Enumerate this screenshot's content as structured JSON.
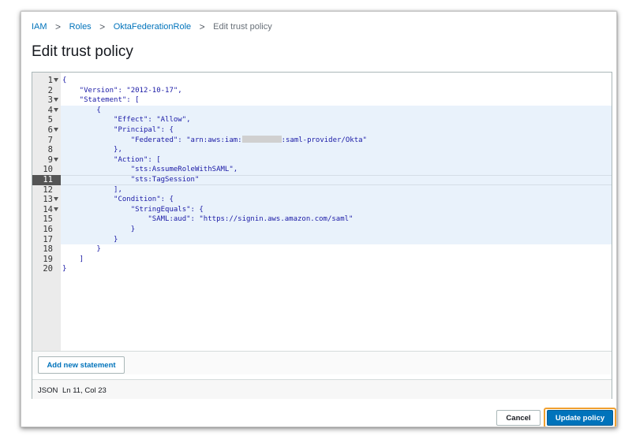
{
  "breadcrumb": {
    "items": [
      "IAM",
      "Roles",
      "OktaFederationRole",
      "Edit trust policy"
    ],
    "separator": ">"
  },
  "page_title": "Edit trust policy",
  "editor": {
    "lines": [
      {
        "n": "1",
        "fold": true,
        "text": "{"
      },
      {
        "n": "2",
        "fold": false,
        "text": "    \"Version\": \"2012-10-17\","
      },
      {
        "n": "3",
        "fold": true,
        "text": "    \"Statement\": ["
      },
      {
        "n": "4",
        "fold": true,
        "text": "        {"
      },
      {
        "n": "5",
        "fold": false,
        "text": "            \"Effect\": \"Allow\","
      },
      {
        "n": "6",
        "fold": true,
        "text": "            \"Principal\": {"
      },
      {
        "n": "7",
        "fold": false,
        "text": "                \"Federated\": \"arn:aws:iam:",
        "redacted": true,
        "after": ":saml-provider/Okta\""
      },
      {
        "n": "8",
        "fold": false,
        "text": "            },"
      },
      {
        "n": "9",
        "fold": true,
        "text": "            \"Action\": ["
      },
      {
        "n": "10",
        "fold": false,
        "text": "                \"sts:AssumeRoleWithSAML\","
      },
      {
        "n": "11",
        "fold": false,
        "text": "                \"sts:TagSession\""
      },
      {
        "n": "12",
        "fold": false,
        "text": "            ],"
      },
      {
        "n": "13",
        "fold": true,
        "text": "            \"Condition\": {"
      },
      {
        "n": "14",
        "fold": true,
        "text": "                \"StringEquals\": {"
      },
      {
        "n": "15",
        "fold": false,
        "text": "                    \"SAML:aud\": \"https://signin.aws.amazon.com/saml\""
      },
      {
        "n": "16",
        "fold": false,
        "text": "                }"
      },
      {
        "n": "17",
        "fold": false,
        "text": "            }"
      },
      {
        "n": "18",
        "fold": false,
        "text": "        }"
      },
      {
        "n": "19",
        "fold": false,
        "text": "    ]"
      },
      {
        "n": "20",
        "fold": false,
        "text": "}"
      }
    ],
    "active_line": "11",
    "highlighted_range": [
      "4",
      "17"
    ]
  },
  "add_statement_label": "Add new statement",
  "status": {
    "language": "JSON",
    "position": "Ln 11, Col 23"
  },
  "buttons": {
    "cancel": "Cancel",
    "update": "Update policy"
  },
  "colors": {
    "link": "#0073bb",
    "primary": "#0073bb",
    "focus_ring": "#f0a030",
    "highlight": "#e9f2fb"
  }
}
